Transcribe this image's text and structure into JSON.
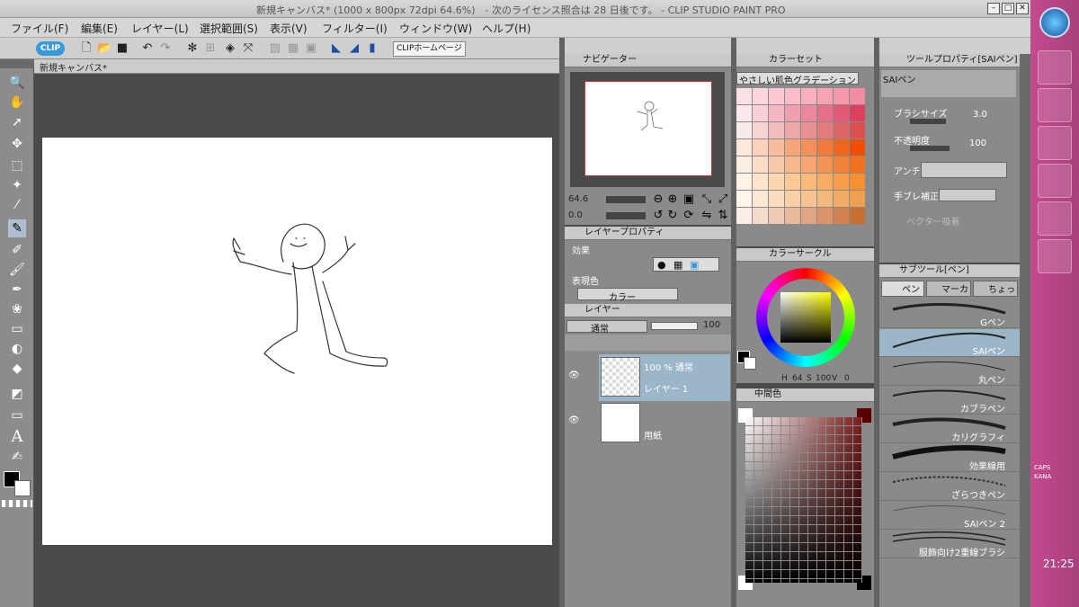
{
  "window": {
    "title": "新規キャンバス* (1000 x 800px 72dpi 64.6%)　- 次のライセンス照合は 28 日後です。 - CLIP STUDIO PAINT PRO"
  },
  "menu": [
    "ファイル(F)",
    "編集(E)",
    "レイヤー(L)",
    "選択範囲(S)",
    "表示(V)",
    "フィルター(I)",
    "ウィンドウ(W)",
    "ヘルプ(H)"
  ],
  "command_bar": {
    "clip_label": "CLIPホームページ"
  },
  "canvas": {
    "tab_label": "新規キャンバス*"
  },
  "navigator": {
    "title": "ナビゲーター",
    "zoom": "64.6",
    "rotation": "0.0"
  },
  "color_set": {
    "title": "カラーセット",
    "set_name": "やさしい肌色グラデーション"
  },
  "tool_property": {
    "title": "ツールプロパティ[SAIペン]",
    "tool_name": "SAIペン",
    "brush_size_label": "ブラシサイズ",
    "brush_size": "3.0",
    "opacity_label": "不透明度",
    "opacity": "100",
    "aa_label": "アンチ",
    "stabilizer_label": "手ブレ補正",
    "vector_label": "ベクター吸着"
  },
  "layer_property": {
    "title": "レイヤープロパティ",
    "effect_label": "効果",
    "color_label": "表現色",
    "color_value": "カラー"
  },
  "layers": {
    "title": "レイヤー",
    "blend": "通常",
    "opacity": "100",
    "items": [
      {
        "info": "100 % 通常",
        "name": "レイヤー 1"
      },
      {
        "info": "",
        "name": "用紙"
      }
    ]
  },
  "color_circle": {
    "title": "カラーサークル",
    "h_label": "H",
    "h": "64",
    "s_label": "S",
    "s": "100",
    "v_label": "V",
    "v": "0"
  },
  "intermediate": {
    "title": "中間色"
  },
  "sub_tool": {
    "title": "サブツール[ペン]",
    "tabs": [
      "ペン",
      "マーカー",
      "ちょっと"
    ],
    "items": [
      "Gペン",
      "SAIペン",
      "丸ペン",
      "カブラペン",
      "カリグラフィ",
      "効果線用",
      "ざらつきペン",
      "SAIペン 2",
      "服飾向け2重線ブラシ"
    ]
  },
  "taskbar": {
    "time": "21:25",
    "caps": "CAPS",
    "kana": "KANA"
  },
  "colors": {
    "accent": "#9cb6c9",
    "main_color": "#000000",
    "sub_color": "#ffffff"
  }
}
